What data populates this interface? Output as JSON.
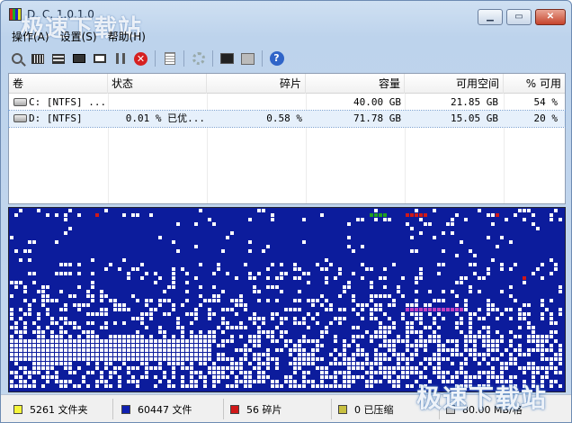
{
  "window": {
    "title": "D. C. 1.0.1.0"
  },
  "watermark": {
    "top": "极速下载站",
    "bottom": "极速下载站"
  },
  "titlebar": {
    "minimize": "▁",
    "maximize": "▭",
    "close": "✕"
  },
  "menu": [
    {
      "label": "操作(A)"
    },
    {
      "label": "设置(S)"
    },
    {
      "label": "帮助(H)"
    }
  ],
  "toolbar": {
    "icons": [
      "analyze-icon",
      "defrag-icon",
      "defrag-full-icon",
      "optimize-icon",
      "frame-icon",
      "pause-icon",
      "stop-icon",
      "report-icon",
      "settings-icon",
      "console-icon",
      "boot-icon",
      "help-icon"
    ],
    "stop_glyph": "✕",
    "help_glyph": "?"
  },
  "volumes": {
    "headers": [
      "卷",
      "状态",
      "碎片",
      "容量",
      "可用空间",
      "% 可用"
    ],
    "rows": [
      {
        "volume": "C: [NTFS]  ...",
        "status": "",
        "fragmentation": "",
        "capacity": "40.00 GB",
        "free": "21.85 GB",
        "percent_free": "54 %",
        "selected": false
      },
      {
        "volume": "D: [NTFS]",
        "status": "0.01 % 已优...",
        "fragmentation": "0.58 %",
        "capacity": "71.78 GB",
        "free": "15.05 GB",
        "percent_free": "20 %",
        "selected": true
      }
    ]
  },
  "cluster_map": {
    "colors": {
      "background": "#0c1c9c",
      "free": "#ffffff",
      "fragmented": "#d01818",
      "system": "#20a020",
      "mft": "#c040c0"
    }
  },
  "status": {
    "items": [
      {
        "label": "5261 文件夹",
        "color": "#f5f53a"
      },
      {
        "label": "60447 文件",
        "color": "#1020b0"
      },
      {
        "label": "56 碎片",
        "color": "#d01818"
      },
      {
        "label": "0 已压缩",
        "color": "#c8c040"
      },
      {
        "label": "80.00 MB/格",
        "color": "#c8c8c8"
      }
    ]
  }
}
